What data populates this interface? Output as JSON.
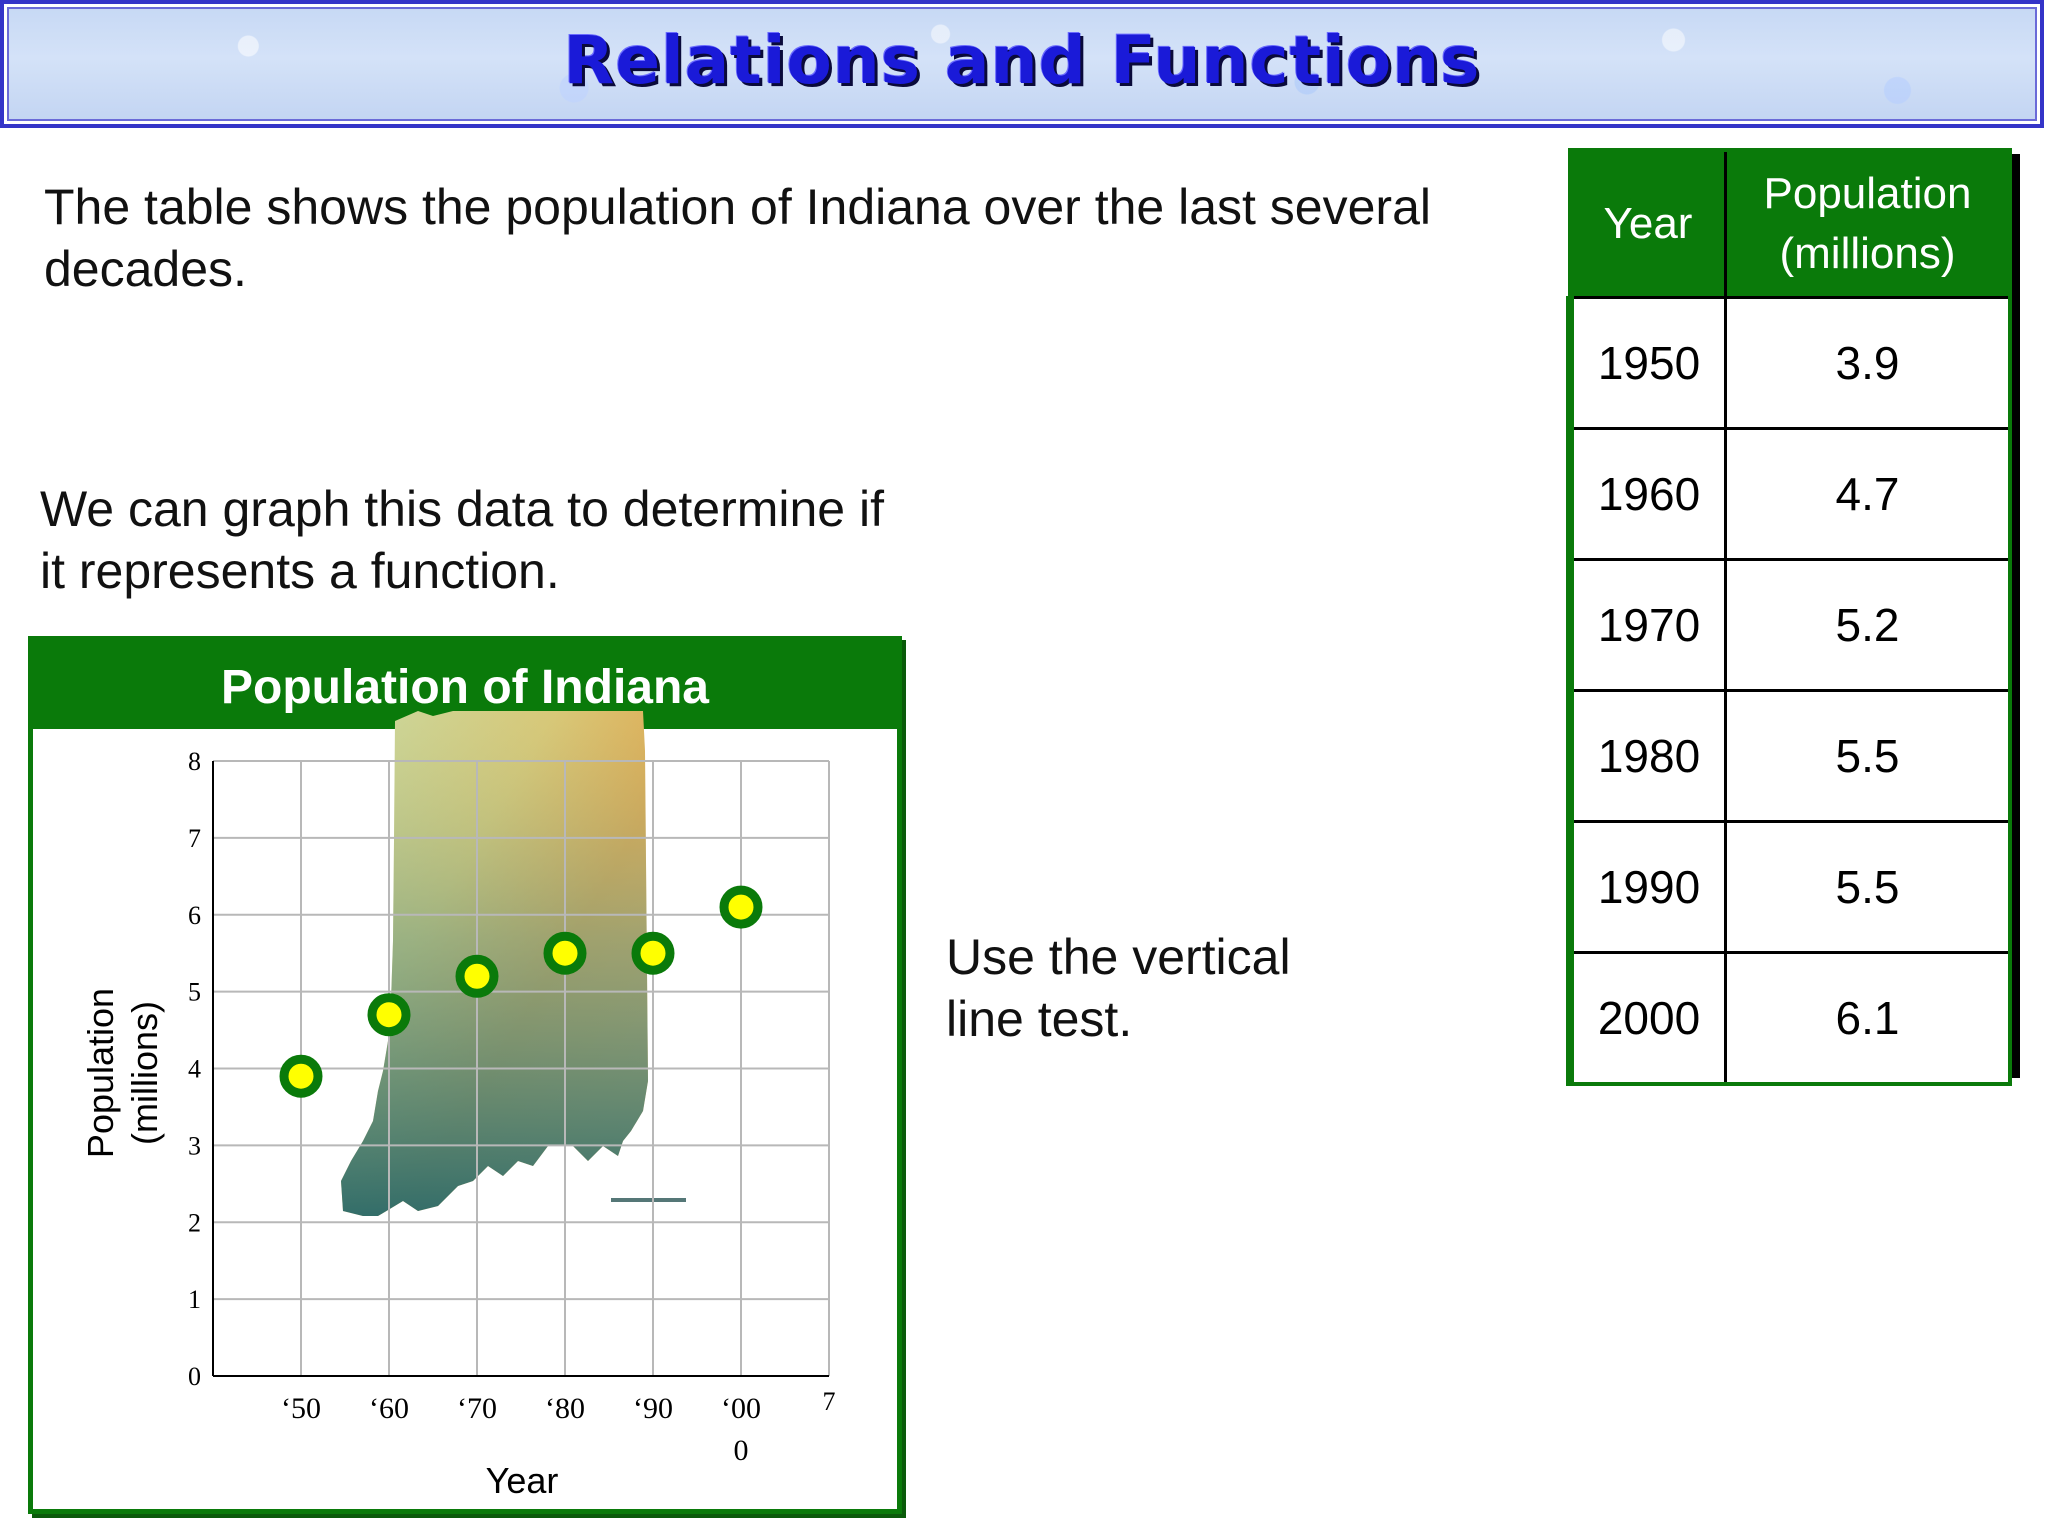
{
  "slide_title": "Relations and Functions",
  "intro_text": "The table shows the population of Indiana over the last several decades.",
  "graph_text": "We can graph this data to determine if it represents a function.",
  "vertical_line_text": "Use the vertical line test.",
  "table": {
    "headers": [
      "Year",
      "Population (millions)"
    ],
    "rows": [
      [
        "1950",
        "3.9"
      ],
      [
        "1960",
        "4.7"
      ],
      [
        "1970",
        "5.2"
      ],
      [
        "1980",
        "5.5"
      ],
      [
        "1990",
        "5.5"
      ],
      [
        "2000",
        "6.1"
      ]
    ],
    "header_color": "#0a7a0a"
  },
  "chart_data": {
    "type": "scatter",
    "title": "Population of Indiana",
    "xlabel": "Year",
    "ylabel": "Population (millions)",
    "x": [
      1950,
      1960,
      1970,
      1980,
      1990,
      2000
    ],
    "y": [
      3.9,
      4.7,
      5.2,
      5.5,
      5.5,
      6.1
    ],
    "x_tick_labels": [
      "‘50",
      "‘60",
      "‘70",
      "‘80",
      "‘90",
      "‘00",
      "0",
      "7"
    ],
    "y_ticks": [
      "0",
      "1",
      "2",
      "3",
      "4",
      "5",
      "6",
      "7",
      "8"
    ],
    "ylim": [
      0,
      8
    ],
    "grid": true,
    "background_image": "indiana-map",
    "point_fill": "#ffff00",
    "point_stroke": "#0a7a0a"
  }
}
